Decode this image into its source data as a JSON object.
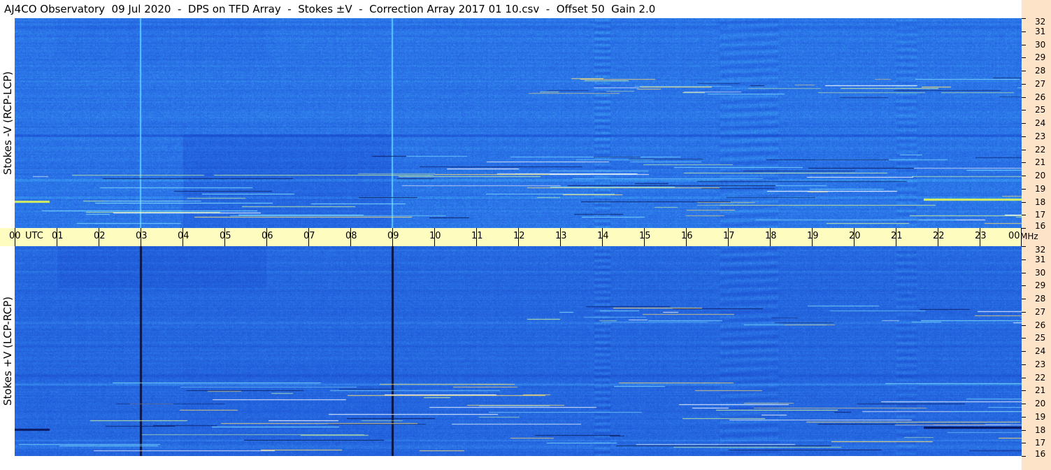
{
  "title": "AJ4CO Observatory  09 Jul 2020  -  DPS on TFD Array  -  Stokes ±V  -  Correction Array 2017 01 10.csv  -  Offset 50  Gain 2.0",
  "chart_data": [
    {
      "type": "heatmap",
      "title": "",
      "ylabel": "Stokes -V (RCP-LCP)",
      "xlabel": "UTC",
      "y_unit": "MHz",
      "ylim": [
        16,
        32
      ],
      "y_ticks": [
        "32",
        "31",
        "30",
        "29",
        "28",
        "27",
        "26",
        "25",
        "24",
        "23",
        "22",
        "21",
        "20",
        "19",
        "18",
        "17",
        "16"
      ],
      "xlim": [
        0,
        24
      ],
      "x_ticks": [
        "00",
        "01",
        "02",
        "03",
        "04",
        "05",
        "06",
        "07",
        "08",
        "09",
        "10",
        "11",
        "12",
        "13",
        "14",
        "15",
        "16",
        "17",
        "18",
        "19",
        "20",
        "21",
        "22",
        "23",
        "00"
      ],
      "colors": {
        "base": "#2a72e8",
        "dark": "#1a4fd0",
        "light": "#3fa8f5"
      }
    },
    {
      "type": "heatmap",
      "title": "",
      "ylabel": "Stokes +V (LCP-RCP)",
      "xlabel": "UTC",
      "y_unit": "MHz",
      "ylim": [
        16,
        32
      ],
      "y_ticks": [
        "32",
        "31",
        "30",
        "29",
        "28",
        "27",
        "26",
        "25",
        "24",
        "23",
        "22",
        "21",
        "20",
        "19",
        "18",
        "17",
        "16"
      ],
      "xlim": [
        0,
        24
      ],
      "x_ticks": [
        "00",
        "01",
        "02",
        "03",
        "04",
        "05",
        "06",
        "07",
        "08",
        "09",
        "10",
        "11",
        "12",
        "13",
        "14",
        "15",
        "16",
        "17",
        "18",
        "19",
        "20",
        "21",
        "22",
        "23",
        "00"
      ],
      "colors": {
        "base": "#2466e0",
        "dark": "#1a48c8",
        "light": "#3a90f0"
      }
    }
  ],
  "axis": {
    "utc_label": "UTC",
    "mhz_label": "MHz"
  }
}
